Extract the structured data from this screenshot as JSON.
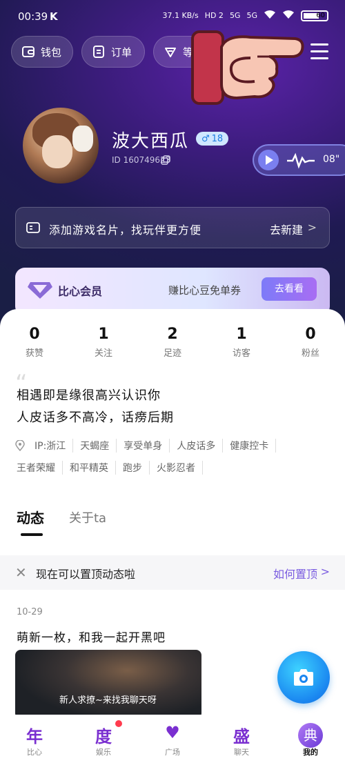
{
  "status_bar": {
    "time": "00:39",
    "k_icon": "K",
    "net_speed": "37.1 KB/s",
    "hd": "HD 2",
    "sig1": "5G",
    "sig2": "5G",
    "battery": "60"
  },
  "top_buttons": {
    "wallet": "钱包",
    "orders": "订单",
    "level": "等"
  },
  "profile": {
    "name": "波大西瓜",
    "gender_age": "18",
    "id_text": "ID 160749623",
    "voice_duration": "08\""
  },
  "game_card": {
    "text": "添加游戏名片，找玩伴更方便",
    "action": "去新建",
    "chevron": ">"
  },
  "vip": {
    "title": "比心会员",
    "subtitle": "赚比心豆免单券",
    "button": "去看看"
  },
  "stats": [
    {
      "num": "0",
      "label": "获赞"
    },
    {
      "num": "1",
      "label": "关注"
    },
    {
      "num": "2",
      "label": "足迹"
    },
    {
      "num": "1",
      "label": "访客"
    },
    {
      "num": "0",
      "label": "粉丝"
    }
  ],
  "bio": {
    "line1": "相遇即是缘很高兴认识你",
    "line2": "人皮话多不高冷，话痨后期"
  },
  "tags_row1": [
    "IP:浙江",
    "天蝎座",
    "享受单身",
    "人皮话多",
    "健康控卡"
  ],
  "tags_row2": [
    "王者荣耀",
    "和平精英",
    "跑步",
    "火影忍者"
  ],
  "tabs": {
    "active": "动态",
    "other": "关于ta"
  },
  "notice": {
    "text": "现在可以置顶动态啦",
    "link": "如何置顶",
    "chevron": ">"
  },
  "post": {
    "date": "10-29",
    "text": "萌新一枚，和我一起开黑吧",
    "image_title": "新人求撩~来找我聊天呀"
  },
  "bottom_nav": [
    {
      "glyph": "年",
      "label": "比心"
    },
    {
      "glyph": "度",
      "label": "娱乐"
    },
    {
      "glyph": "♥",
      "label": "广场"
    },
    {
      "glyph": "盛",
      "label": "聊天"
    },
    {
      "glyph": "典",
      "label": "我的"
    }
  ],
  "colors": {
    "accent_purple": "#7a5ce0",
    "badge_blue": "#1f7ee0",
    "notify_red": "#ff3b4e",
    "camera_blue": "#1a86f0"
  },
  "icons": [
    "wallet-icon",
    "order-icon",
    "level-icon",
    "menu-icon",
    "pointing-hand-icon",
    "copy-icon",
    "play-icon",
    "waveform-icon",
    "game-card-icon",
    "diamond-icon",
    "location-icon",
    "quote-icon",
    "close-icon",
    "camera-icon"
  ]
}
